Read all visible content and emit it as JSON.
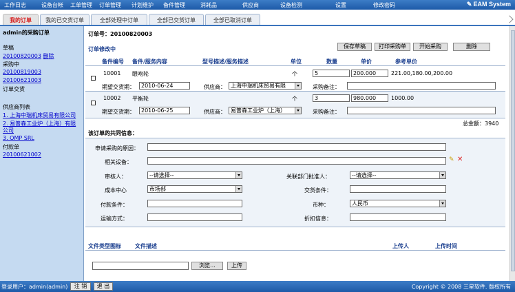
{
  "topbar": {
    "menu": [
      "工作日志",
      "设备台帐",
      "工单管理",
      "订单管理",
      "计划维护",
      "备件管理",
      "消耗品",
      "供应商",
      "设备检测",
      "设置",
      "修改密码"
    ],
    "brand": "EAM System"
  },
  "tabs": [
    "我的订单",
    "我的已交货订单",
    "全部处理中订单",
    "全部已交货订单",
    "全部已取消订单"
  ],
  "left": {
    "title": "admin的采购订单",
    "draft_label": "草稿",
    "draft_order": "20100820003",
    "delete_label": "删除",
    "purchasing_label": "采购中",
    "purchasing_orders": [
      "20100819003",
      "20100621003"
    ],
    "ordered_label": "订单交货",
    "supplier_list_label": "供应商列表",
    "suppliers": [
      "1. 上海中瑞机床贸易有限公司",
      "2. 易普森工业炉（上海）有限",
      "公司",
      "3. OMP SRL"
    ],
    "paid_label": "付款单",
    "paid_order": "20100621002"
  },
  "order": {
    "number_label": "订单号：20100820003",
    "status_label": "订单修改中",
    "buttons": [
      "保存草稿",
      "打印采购单",
      "开始采购",
      "删除"
    ],
    "headers": [
      "备件编号",
      "备件/服务内容",
      "型号描述/服务描述",
      "单位",
      "数量",
      "单价",
      "参考单价"
    ],
    "rows": [
      {
        "code": "10001",
        "name": "眼吻轮",
        "unit": "个",
        "qty": "5",
        "price": "200.000",
        "ref_price": "221.00,180.00,200.00",
        "date_label": "期望交货期：",
        "date": "2010-06-24",
        "supplier_label": "供应商：",
        "supplier": "上海中瑞机床贸易有限",
        "note_label": "采购备注：",
        "note": ""
      },
      {
        "code": "10002",
        "name": "平衡轮",
        "unit": "个",
        "qty": "3",
        "price": "980.000",
        "ref_price": "1000.00",
        "date_label": "期望交货期：",
        "date": "2010-06-25",
        "supplier_label": "供应商：",
        "supplier": "易普森工业炉（上海）",
        "note_label": "采购备注：",
        "note": ""
      }
    ],
    "total_label": "总金额：3940"
  },
  "common": {
    "title": "该订单的共同信息：",
    "reason_label": "申请采购的原因：",
    "equipment_label": "相关设备：",
    "reviewer_label": "审核人：",
    "reviewer_value": "--请选择--",
    "approver_label": "关联部门批准人：",
    "approver_value": "--请选择--",
    "cost_center_label": "成本中心",
    "cost_center_value": "市场部",
    "delivery_terms_label": "交货条件：",
    "payment_terms_label": "付款条件：",
    "currency_label": "币种：",
    "currency_value": "人民币",
    "shipping_label": "运输方式：",
    "discount_label": "折扣信息："
  },
  "files": {
    "headers": [
      "文件类型图标",
      "文件描述",
      "上传人",
      "上传时间"
    ],
    "browse_label": "浏览...",
    "upload_label": "上传"
  },
  "status": {
    "login_label": "登录用户：admin(admin)",
    "help_label": "注 销",
    "logout_label": "退 出",
    "copyright": "Copyright © 2008 三星软件. 版权所有"
  }
}
